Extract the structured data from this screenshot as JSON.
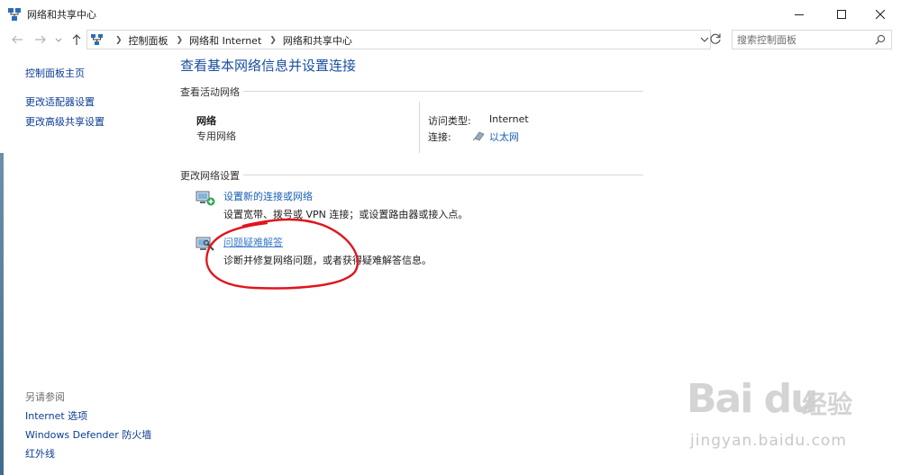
{
  "window": {
    "title": "网络和共享中心"
  },
  "nav": {
    "breadcrumbs": [
      "控制面板",
      "网络和 Internet",
      "网络和共享中心"
    ],
    "search_placeholder": "搜索控制面板"
  },
  "sidebar": {
    "links": [
      "控制面板主页",
      "更改适配器设置",
      "更改高级共享设置"
    ],
    "see_also_heading": "另请参阅",
    "see_also": [
      "Internet 选项",
      "Windows Defender 防火墙",
      "红外线"
    ]
  },
  "main": {
    "title": "查看基本网络信息并设置连接",
    "active_heading": "查看活动网络",
    "network": {
      "name": "网络",
      "kind": "专用网络",
      "access_label": "访问类型:",
      "access_value": "Internet",
      "connection_label": "连接:",
      "connection_value": "以太网"
    },
    "change_heading": "更改网络设置",
    "tasks": [
      {
        "title": "设置新的连接或网络",
        "desc": "设置宽带、拨号或 VPN 连接；或设置路由器或接入点。"
      },
      {
        "title": "问题疑难解答",
        "desc": "诊断并修复网络问题，或者获得疑难解答信息。"
      }
    ]
  },
  "watermark": {
    "logo": "Bai du",
    "cn": "经验",
    "url": "jingyan.baidu.com"
  },
  "colors": {
    "link": "#0b3c95",
    "title": "#1a4fa0",
    "annotation": "#e0141e"
  }
}
